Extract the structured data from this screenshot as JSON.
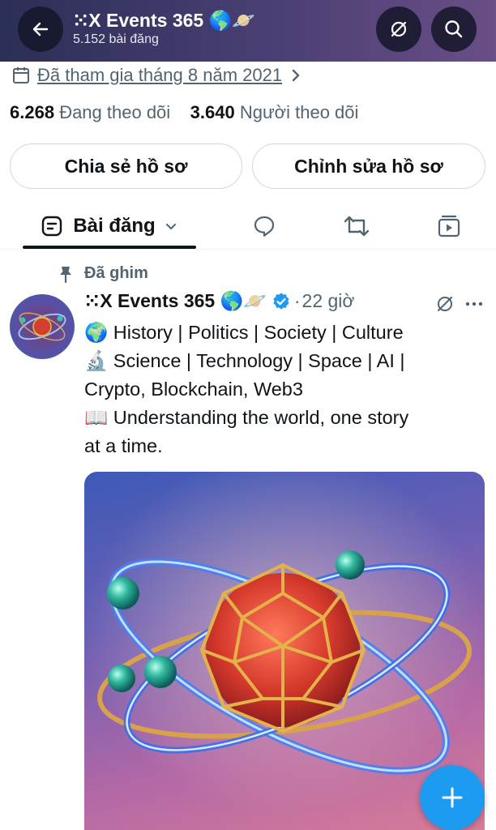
{
  "header": {
    "name": "⁙X Events 365 🌎🪐",
    "posts_count": "5.152 bài đăng"
  },
  "profile": {
    "joined": "Đã tham gia tháng 8 năm 2021",
    "following_count": "6.268",
    "following_label": "Đang theo dõi",
    "followers_count": "3.640",
    "followers_label": "Người theo dõi"
  },
  "buttons": {
    "share": "Chia sẻ hồ sơ",
    "edit": "Chỉnh sửa hồ sơ"
  },
  "tabs": {
    "posts": "Bài đăng"
  },
  "post": {
    "pinned_label": "Đã ghim",
    "author": "⁙X Events 365 🌎🪐",
    "time": "22 giờ",
    "lines": [
      "🌍 History | Politics | Society | Culture",
      "🔬 Science | Technology | Space | AI |",
      "Crypto, Blockchain, Web3",
      "📖 Understanding the world, one story",
      "at a time."
    ]
  },
  "colors": {
    "accent": "#1d9bf0",
    "muted_text": "#536471",
    "text": "#0f1419"
  },
  "icons": [
    "back-arrow-icon",
    "grok-icon",
    "search-icon",
    "calendar-icon",
    "chevron-right-icon",
    "posts-tab-icon",
    "reply-icon",
    "repost-icon",
    "media-icon",
    "pin-icon",
    "verified-icon",
    "more-icon",
    "plus-icon"
  ]
}
